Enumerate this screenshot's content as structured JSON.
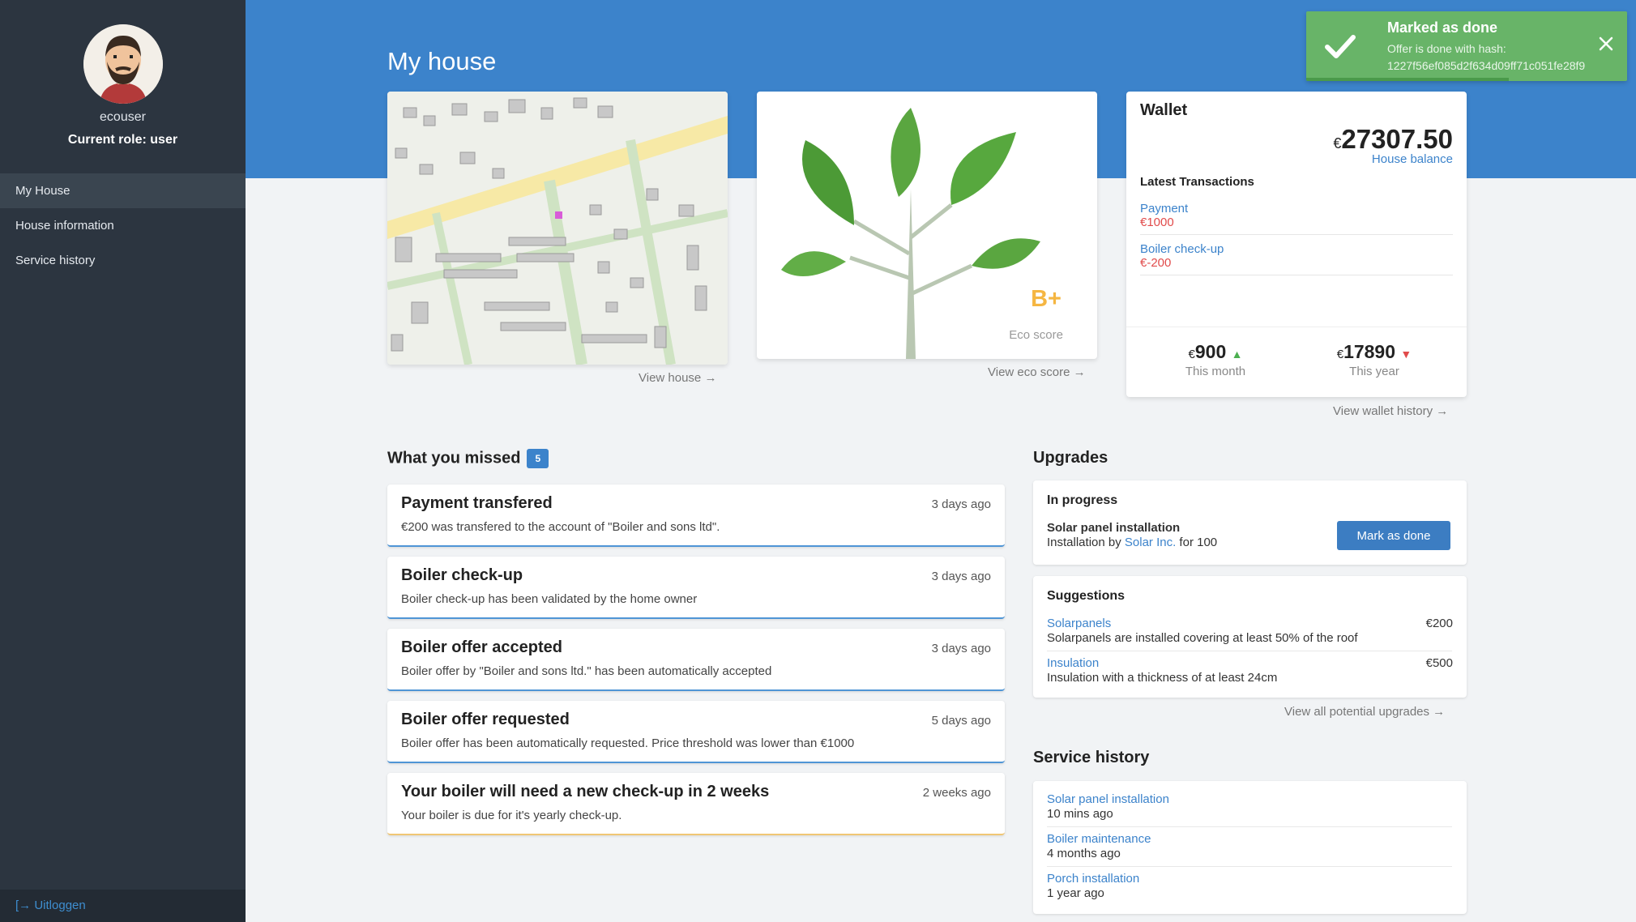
{
  "sidebar": {
    "username": "ecouser",
    "role": "Current role: user",
    "items": [
      {
        "label": "My House",
        "active": true
      },
      {
        "label": "House information",
        "active": false
      },
      {
        "label": "Service history",
        "active": false
      }
    ],
    "logout": "Uitloggen"
  },
  "header": {
    "title": "My house"
  },
  "house": {
    "view_link": "View house →"
  },
  "eco": {
    "grade": "B+",
    "label": "Eco score",
    "view_link": "View eco score →"
  },
  "wallet": {
    "title": "Wallet",
    "currency": "€",
    "balance": "27307.50",
    "balance_label": "House balance",
    "tx_heading": "Latest Transactions",
    "transactions": [
      {
        "name": "Payment",
        "amount": "€1000"
      },
      {
        "name": "Boiler check-up",
        "amount": "€-200"
      }
    ],
    "month_value": "900",
    "month_label": "This month",
    "year_value": "17890",
    "year_label": "This year",
    "view_link": "View wallet history →"
  },
  "missed": {
    "title": "What you missed",
    "count": "5",
    "items": [
      {
        "title": "Payment transfered",
        "time": "3 days ago",
        "desc": "€200 was transfered to the account of \"Boiler and sons ltd\"."
      },
      {
        "title": "Boiler check-up",
        "time": "3 days ago",
        "desc": "Boiler check-up has been validated by the home owner"
      },
      {
        "title": "Boiler offer accepted",
        "time": "3 days ago",
        "desc": "Boiler offer by \"Boiler and sons ltd.\" has been automatically accepted"
      },
      {
        "title": "Boiler offer requested",
        "time": "5 days ago",
        "desc": "Boiler offer has been automatically requested. Price threshold was lower than €1000"
      },
      {
        "title": "Your boiler will need a new check-up in 2 weeks",
        "time": "2 weeks ago",
        "desc": "Your boiler is due for it's yearly check-up."
      }
    ]
  },
  "upgrades": {
    "title": "Upgrades",
    "in_progress": {
      "heading": "In progress",
      "item": "Solar panel installation",
      "by_prefix": "Installation by ",
      "by_company": "Solar Inc.",
      "by_suffix": " for 100",
      "button": "Mark as done"
    },
    "suggestions": {
      "heading": "Suggestions",
      "items": [
        {
          "name": "Solarpanels",
          "desc": "Solarpanels are installed covering at least 50% of the roof",
          "price": "€200"
        },
        {
          "name": "Insulation",
          "desc": "Insulation with a thickness of at least 24cm",
          "price": "€500"
        }
      ]
    },
    "view_link": "View all potential upgrades →"
  },
  "service_history": {
    "title": "Service history",
    "items": [
      {
        "name": "Solar panel installation",
        "time": "10 mins ago"
      },
      {
        "name": "Boiler maintenance",
        "time": "4 months ago"
      },
      {
        "name": "Porch installation",
        "time": "1 year ago"
      }
    ]
  },
  "toast": {
    "title": "Marked as done",
    "message": "Offer is done with hash:",
    "hash": "1227f56ef085d2f634d09ff71c051fe28f9"
  }
}
